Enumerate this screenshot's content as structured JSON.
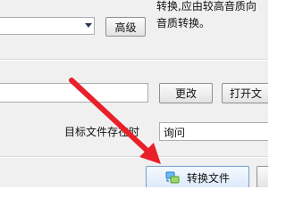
{
  "format_section": {
    "advanced_button": "高级",
    "note_lines": [
      "转换,应由较高音质向",
      "音质转换。"
    ]
  },
  "output_section": {
    "change_button": "更改",
    "open_button": "打开文",
    "target_label": "目标文件存在时",
    "target_value": "询问"
  },
  "actions": {
    "convert_button": "转换文件",
    "convert_icon": "convert-icon"
  },
  "colors": {
    "panel_bg": "#f0f0f0",
    "arrow": "#e8202a",
    "convert_accent": "#2a7fd4"
  }
}
